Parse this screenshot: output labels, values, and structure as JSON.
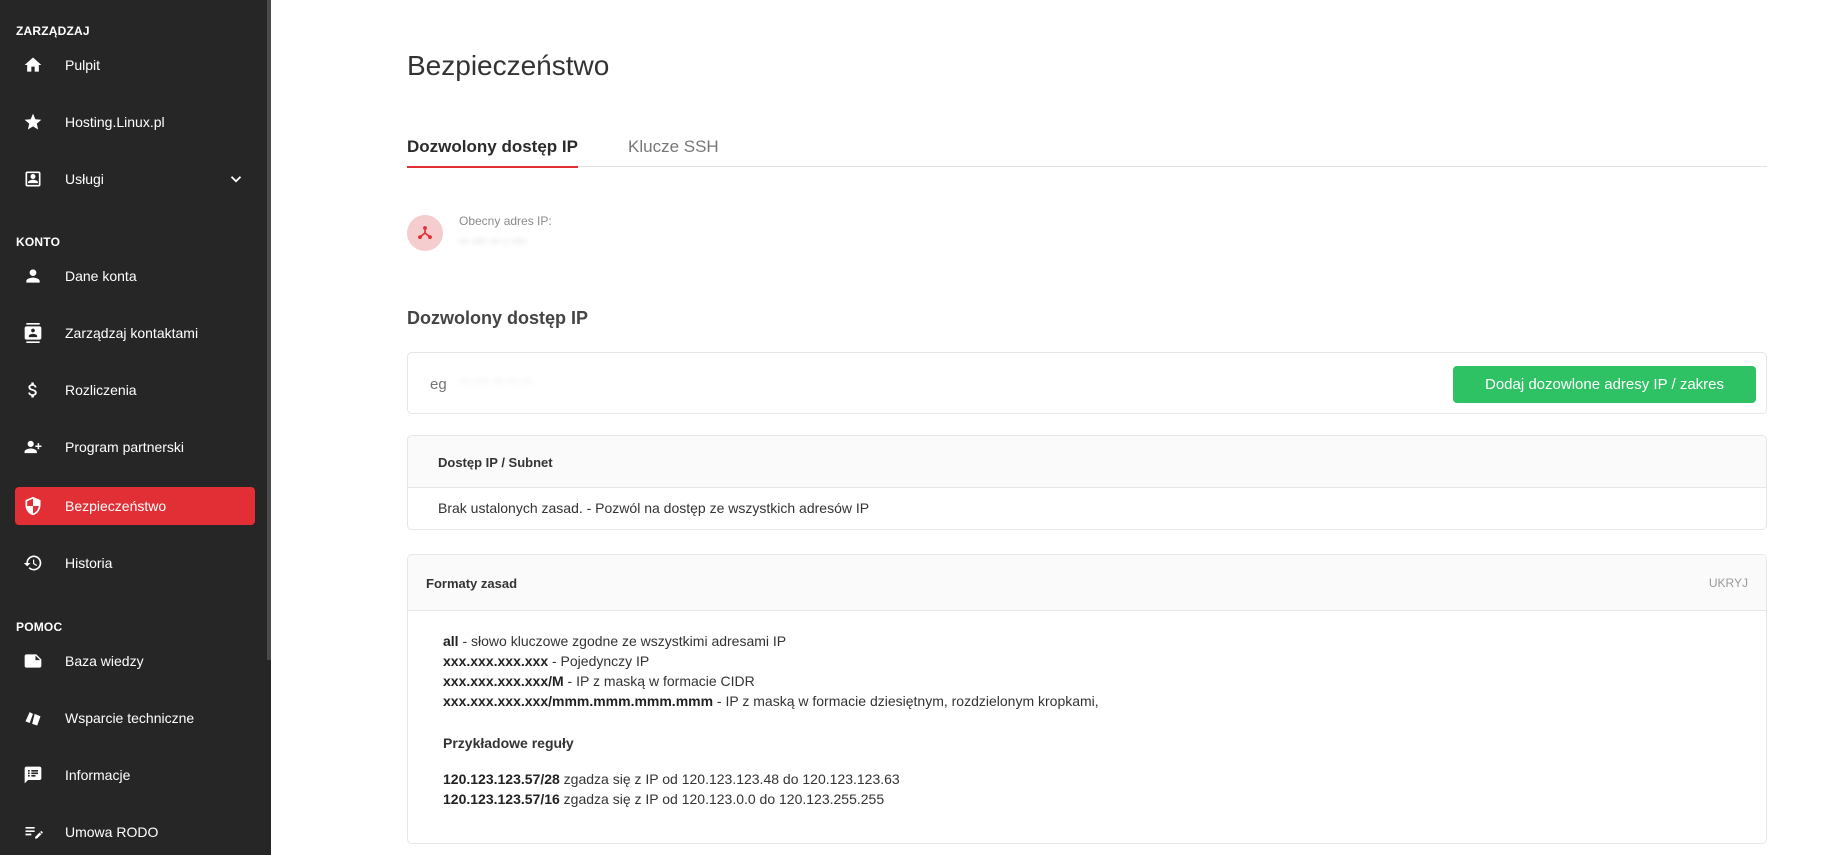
{
  "sidebar": {
    "sections": {
      "manage": "ZARZĄDZAJ",
      "account": "KONTO",
      "help": "POMOC"
    },
    "items": [
      {
        "label": "Pulpit",
        "icon": "home-icon"
      },
      {
        "label": "Hosting.Linux.pl",
        "icon": "star-icon"
      },
      {
        "label": "Usługi",
        "icon": "services-icon"
      },
      {
        "label": "Dane konta",
        "icon": "person-icon"
      },
      {
        "label": "Zarządzaj kontaktami",
        "icon": "contacts-icon"
      },
      {
        "label": "Rozliczenia",
        "icon": "dollar-icon"
      },
      {
        "label": "Program partnerski",
        "icon": "add-person-icon"
      },
      {
        "label": "Bezpieczeństwo",
        "icon": "shield-icon",
        "active": true
      },
      {
        "label": "Historia",
        "icon": "history-icon"
      },
      {
        "label": "Baza wiedzy",
        "icon": "note-icon"
      },
      {
        "label": "Wsparcie techniczne",
        "icon": "support-icon"
      },
      {
        "label": "Informacje",
        "icon": "feedback-icon"
      },
      {
        "label": "Umowa RODO",
        "icon": "edit-list-icon"
      }
    ]
  },
  "page": {
    "title": "Bezpieczeństwo",
    "tabs": [
      {
        "label": "Dozwolony dostęp IP",
        "active": true
      },
      {
        "label": "Klucze SSH",
        "active": false
      }
    ],
    "current_ip": {
      "label": "Obecny adres IP:",
      "value": "·· ··· ·· · ···"
    },
    "allowed_heading": "Dozwolony dostęp IP",
    "add_form": {
      "placeholder": "eg",
      "placeholder_blurred": "·· ··· ·· ·· ··",
      "button_label": "Dodaj dozowlone adresy IP / zakres"
    },
    "table": {
      "header": "Dostęp IP / Subnet",
      "empty_row": "Brak ustalonych zasad. - Pozwól na dostęp ze wszystkich adresów IP"
    },
    "formats": {
      "title": "Formaty zasad",
      "toggle": "UKRYJ",
      "rules": [
        {
          "key": "all",
          "desc": " - słowo kluczowe zgodne ze wszystkimi adresami IP"
        },
        {
          "key": "xxx.xxx.xxx.xxx",
          "desc": " - Pojedynczy IP"
        },
        {
          "key": "xxx.xxx.xxx.xxx/M",
          "desc": " - IP z maską w formacie CIDR"
        },
        {
          "key": "xxx.xxx.xxx.xxx/mmm.mmm.mmm.mmm",
          "desc": " - IP z maską w formacie dziesiętnym, rozdzielonym kropkami,"
        }
      ],
      "examples_title": "Przykładowe reguły",
      "examples": [
        {
          "key": "120.123.123.57/28",
          "desc": " zgadza się z IP od 120.123.123.48 do 120.123.123.63"
        },
        {
          "key": "120.123.123.57/16",
          "desc": " zgadza się z IP od 120.123.0.0 do 120.123.255.255"
        }
      ]
    }
  },
  "colors": {
    "sidebar_bg": "#262626",
    "accent_red": "#e12f35",
    "button_green": "#2fc265"
  }
}
